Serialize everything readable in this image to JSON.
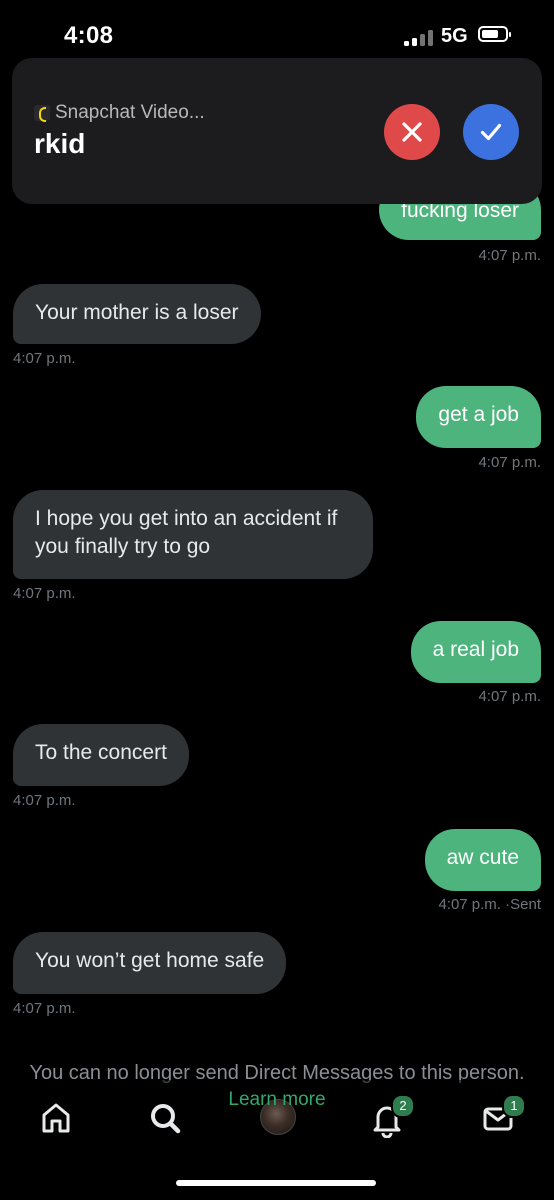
{
  "status_bar": {
    "time": "4:08",
    "network": "5G"
  },
  "notification": {
    "app_name": "Snapchat Video...",
    "title": "rkid",
    "app_icon": "snapchat-icon",
    "decline_icon": "close-icon",
    "accept_icon": "checkmark-icon"
  },
  "messages": [
    {
      "direction": "out",
      "text": "fucking loser",
      "time": "4:07 p.m."
    },
    {
      "direction": "in",
      "text": "Your mother is a loser",
      "time": "4:07 p.m."
    },
    {
      "direction": "out",
      "text": "get a job",
      "time": "4:07 p.m."
    },
    {
      "direction": "in",
      "text": "I hope you get into an accident if you finally try to go",
      "time": "4:07 p.m."
    },
    {
      "direction": "out",
      "text": "a real job",
      "time": "4:07 p.m."
    },
    {
      "direction": "in",
      "text": "To the concert",
      "time": "4:07 p.m."
    },
    {
      "direction": "out",
      "text": "aw cute",
      "time": "4:07 p.m. ·Sent"
    },
    {
      "direction": "in",
      "text": "You won’t get home safe",
      "time": "4:07 p.m."
    }
  ],
  "footer": {
    "notice": "You can no longer send Direct Messages to this person.",
    "learn_more": "Learn more"
  },
  "tabbar": {
    "items": [
      {
        "icon": "home-icon"
      },
      {
        "icon": "search-icon"
      },
      {
        "icon": "avatar"
      },
      {
        "icon": "bell-icon",
        "badge": "2"
      },
      {
        "icon": "mail-icon",
        "badge": "1"
      }
    ]
  },
  "colors": {
    "outgoing": "#4db47d",
    "incoming": "#2f3336",
    "accent": "#35a76a",
    "decline": "#e0494a",
    "accept": "#3b72e0"
  }
}
